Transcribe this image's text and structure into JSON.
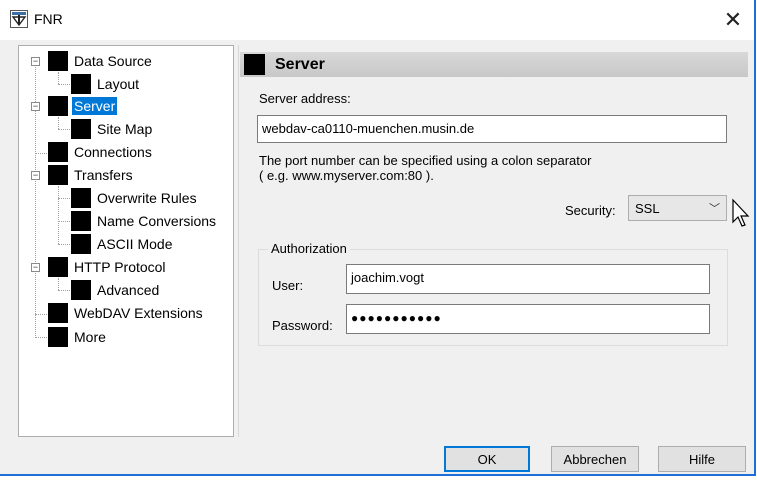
{
  "window": {
    "title": "FNR"
  },
  "tree": {
    "items": [
      {
        "label": "Data Source"
      },
      {
        "label": "Layout"
      },
      {
        "label": "Server"
      },
      {
        "label": "Site Map"
      },
      {
        "label": "Connections"
      },
      {
        "label": "Transfers"
      },
      {
        "label": "Overwrite Rules"
      },
      {
        "label": "Name Conversions"
      },
      {
        "label": "ASCII Mode"
      },
      {
        "label": "HTTP Protocol"
      },
      {
        "label": "Advanced"
      },
      {
        "label": "WebDAV Extensions"
      },
      {
        "label": "More"
      }
    ],
    "selected": "Server"
  },
  "panel": {
    "title": "Server",
    "server_address_label": "Server address:",
    "server_address_value": "webdav-ca0110-muenchen.musin.de",
    "hint_line1": "The port number can be specified using a colon separator",
    "hint_line2": "( e.g. www.myserver.com:80 ).",
    "security_label": "Security:",
    "security_value": "SSL",
    "authorization_title": "Authorization",
    "user_label": "User:",
    "user_value": "joachim.vogt",
    "password_label": "Password:",
    "password_value": "●●●●●●●●●●●"
  },
  "buttons": {
    "ok": "OK",
    "cancel": "Abbrechen",
    "help": "Hilfe"
  },
  "colors": {
    "selection": "#0078d7",
    "window_border": "#1f6fd8"
  }
}
